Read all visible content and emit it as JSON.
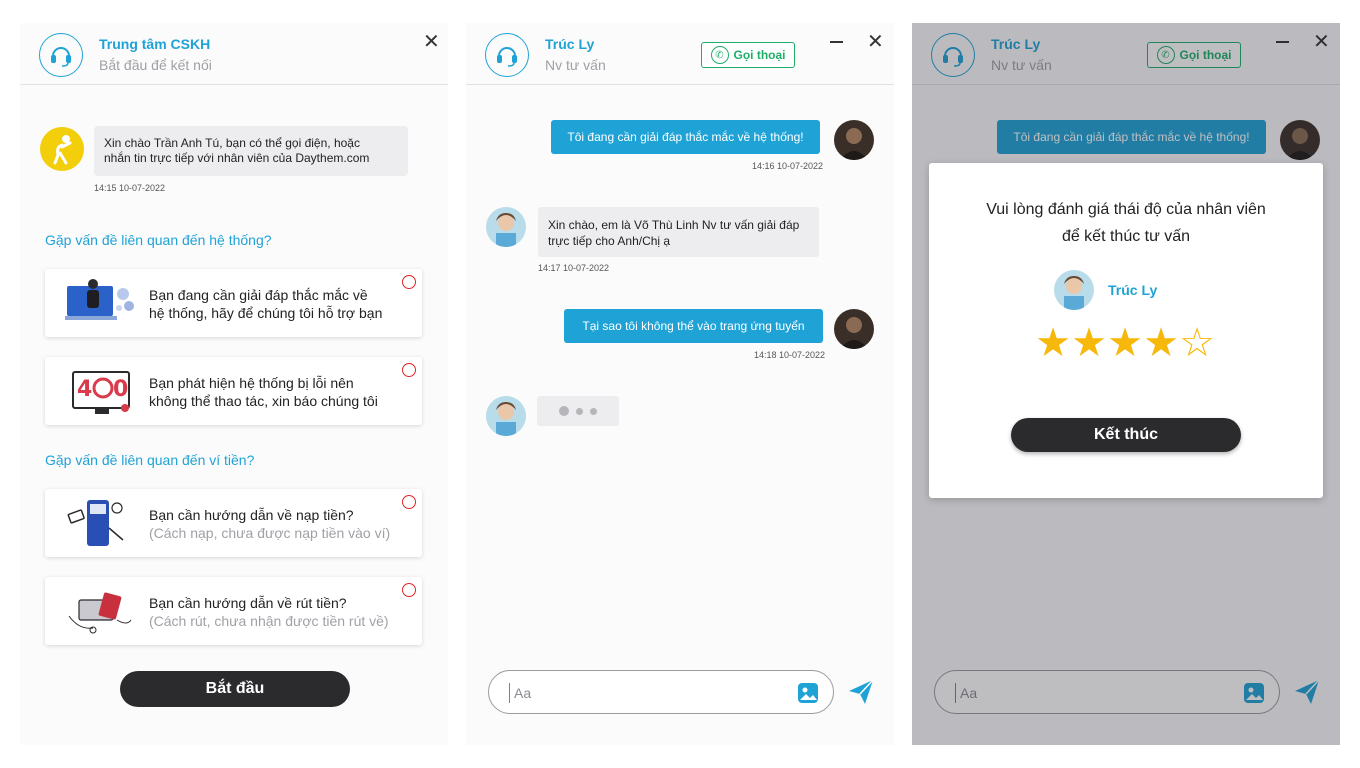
{
  "panel1": {
    "title": "Trung tâm CSKH",
    "subtitle": "Bắt đầu để kết nối",
    "close": "✕",
    "greeting_line1": "Xin chào Trần Anh Tú, bạn có thể gọi điện, hoặc",
    "greeting_line2": "nhắn tin trực tiếp với nhân viên của Daythem.com",
    "greeting_time": "14:15 10-07-2022",
    "section1": "Gặp vấn đề liên quan đến hệ thống?",
    "section2": "Gặp vấn đề liên quan đến ví tiền?",
    "options": [
      {
        "line1": "Bạn đang cần giải đáp thắc mắc về",
        "line2": "hệ thống, hãy để chúng tôi hỗ trợ bạn"
      },
      {
        "line1": "Bạn phát hiện hệ thống bị lỗi nên",
        "line2": "không thể thao tác, xin báo chúng tôi"
      },
      {
        "line1": "Bạn cần hướng dẫn về nạp tiền?",
        "line2": "(Cách nạp, chưa được nạp tiền vào ví)"
      },
      {
        "line1": "Bạn cần hướng dẫn về rút tiền?",
        "line2": "(Cách rút, chưa nhận được tiền rút về)"
      }
    ],
    "start_button": "Bắt đầu"
  },
  "chat": {
    "agent_name": "Trúc Ly",
    "agent_role": "Nv tư vấn",
    "call_label": "Gọi thoại",
    "close": "✕",
    "messages": [
      {
        "text": "Tôi đang cần giải đáp thắc mắc về hệ thống!",
        "time": "14:16 10-07-2022"
      },
      {
        "text_line1": "Xin chào, em là Võ Thù Linh Nv tư vấn giải đáp",
        "text_line2": "trực tiếp cho Anh/Chị ạ",
        "time": "14:17 10-07-2022"
      },
      {
        "text": "Tại sao tôi không thể vào trang ứng tuyển",
        "time": "14:18 10-07-2022"
      }
    ],
    "input_placeholder": "Aa"
  },
  "rating": {
    "title_line1": "Vui lòng đánh giá thái độ của nhân viên",
    "title_line2": "để kết thúc tư vấn",
    "agent_name": "Trúc Ly",
    "stars_filled": 4,
    "stars_total": 5,
    "star_filled_glyph": "★",
    "star_empty_glyph": "☆",
    "finish_button": "Kết thúc"
  },
  "colors": {
    "accent": "#1fa3d6",
    "call_green": "#1fae6a",
    "radio_red": "#e02424",
    "star": "#f6b80a",
    "dark_button": "#2b2b2e"
  }
}
